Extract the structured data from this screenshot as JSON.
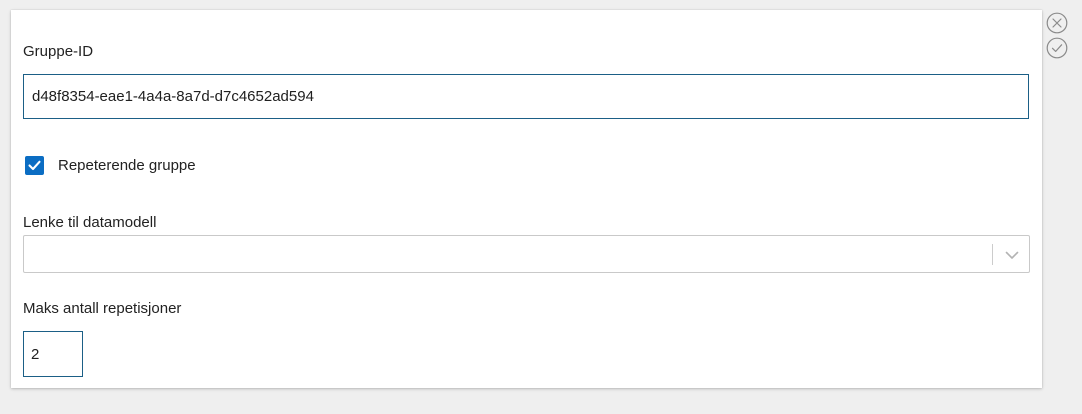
{
  "form": {
    "group_id": {
      "label": "Gruppe-ID",
      "value": "d48f8354-eae1-4a4a-8a7d-d7c4652ad594"
    },
    "repeating_group": {
      "label": "Repeterende gruppe",
      "checked": true
    },
    "data_model_link": {
      "label": "Lenke til datamodell",
      "value": ""
    },
    "max_repetitions": {
      "label": "Maks antall repetisjoner",
      "value": "2"
    }
  },
  "actions": {
    "cancel_icon": "circle-x-icon",
    "confirm_icon": "circle-check-icon"
  },
  "colors": {
    "accent": "#0b6dc3",
    "input_border": "#1b5f86",
    "background": "#efefef",
    "icon_gray": "#8a8a8a"
  }
}
